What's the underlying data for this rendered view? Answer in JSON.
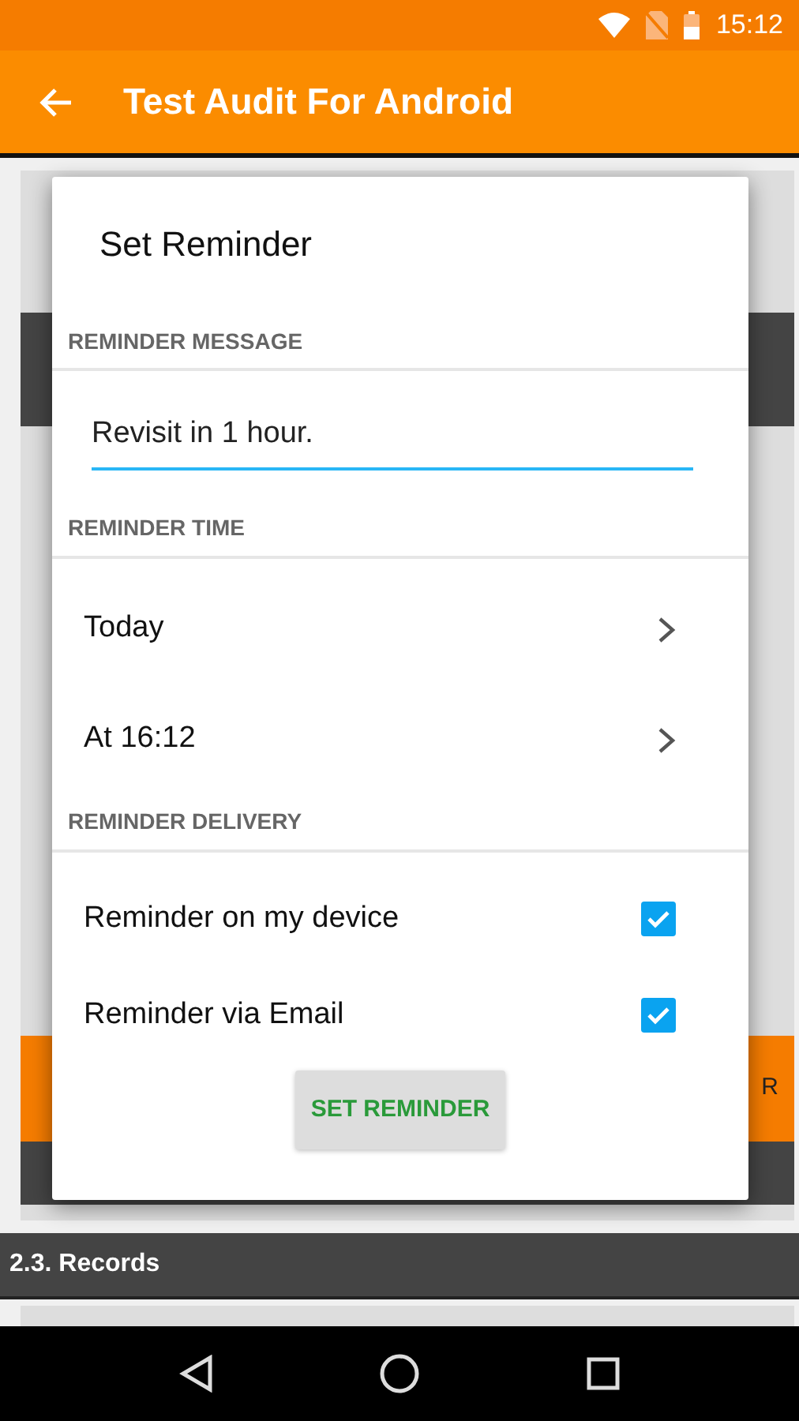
{
  "status_bar": {
    "time": "15:12"
  },
  "app_bar": {
    "title": "Test Audit For Android"
  },
  "background": {
    "button_fragment": "R",
    "section_title": "2.3. Records"
  },
  "dialog": {
    "title": "Set Reminder",
    "sections": [
      {
        "header": "REMINDER MESSAGE",
        "kind": "input",
        "value": "Revisit in 1 hour."
      },
      {
        "header": "REMINDER TIME",
        "kind": "links",
        "items": [
          {
            "label": "Today"
          },
          {
            "label": "At 16:12"
          }
        ]
      },
      {
        "header": "REMINDER DELIVERY",
        "kind": "checks",
        "items": [
          {
            "label": "Reminder on my device",
            "checked": true
          },
          {
            "label": "Reminder via Email",
            "checked": true
          }
        ]
      }
    ],
    "button": "SET REMINDER"
  }
}
